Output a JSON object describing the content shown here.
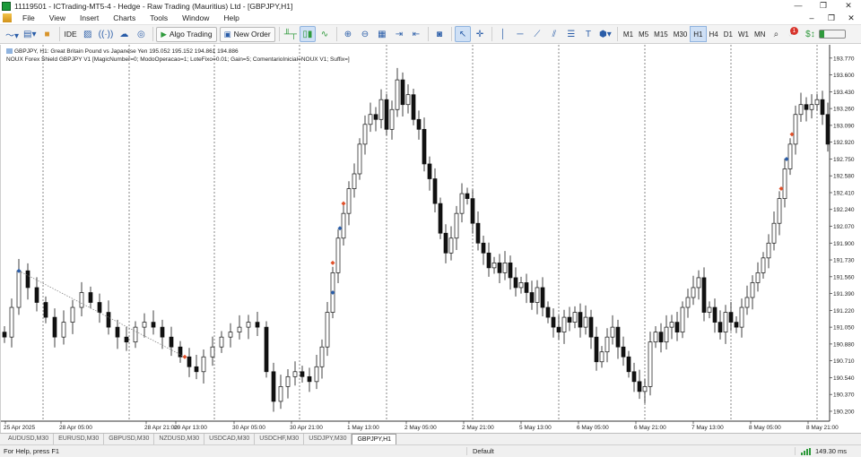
{
  "window": {
    "title": "11119501 - ICTrading-MT5-4 - Hedge - Raw Trading (Mauritius) Ltd - [GBPJPY,H1]",
    "minimize": "—",
    "restore": "❐",
    "close": "✕"
  },
  "menu": {
    "items": [
      "File",
      "View",
      "Insert",
      "Charts",
      "Tools",
      "Window",
      "Help"
    ],
    "right": [
      "–",
      "❐",
      "✕"
    ]
  },
  "toolbar": {
    "ide_label": "IDE",
    "algo_trading_label": "Algo Trading",
    "new_order_label": "New Order",
    "timeframes": [
      "M1",
      "M5",
      "M15",
      "M30",
      "H1",
      "H4",
      "D1",
      "W1",
      "MN"
    ],
    "active_timeframe": "H1",
    "notification_count": "1",
    "icons": {
      "chart-type": "line-chart-icon",
      "templates": "template-icon",
      "market": "market-icon",
      "signals": "signal-icon",
      "vps": "vps-icon",
      "zoom-in": "zoom-in-icon",
      "zoom-out": "zoom-out-icon",
      "crosshair": "crosshair-icon",
      "search": "search-icon"
    }
  },
  "chart": {
    "info_line1": "GBPJPY, H1:  Great Britain Pound vs Japanese Yen  195.052 195.152 194.861 194.886",
    "info_line2": "NOUX Forex Shield GBPJPY V1 [MagicNumber=0; ModoOperacao=1; LoteFixo=0.01; Gain=5; ComentarioInicial=NOUX V1; Suffix=]",
    "up_color": "#111111",
    "down_color": "#111111",
    "buy_marker_color": "#2a5da8",
    "sell_marker_color": "#e0502a",
    "price_labels": [
      "193.770",
      "193.600",
      "193.430",
      "193.260",
      "193.090",
      "192.920",
      "192.750",
      "192.580",
      "192.410",
      "192.240",
      "192.070",
      "191.900",
      "191.730",
      "191.560",
      "191.390",
      "191.220",
      "191.050",
      "190.880",
      "190.710",
      "190.540",
      "190.370",
      "190.200"
    ],
    "time_labels": [
      "25 Apr 2025",
      "28 Apr 05:00",
      "28 Apr 21:00",
      "29 Apr 13:00",
      "30 Apr 05:00",
      "30 Apr 21:00",
      "1 May 13:00",
      "2 May 05:00",
      "2 May 21:00",
      "5 May 13:00",
      "6 May 05:00",
      "6 May 21:00",
      "7 May 13:00",
      "8 May 05:00",
      "8 May 21:00"
    ],
    "ylim": [
      190.1,
      193.85
    ]
  },
  "bottom_tabs": {
    "items": [
      "AUDUSD,M30",
      "EURUSD,M30",
      "GBPUSD,M30",
      "NZDUSD,M30",
      "USDCAD,M30",
      "USDCHF,M30",
      "USDJPY,M30",
      "GBPJPY,H1"
    ],
    "active": "GBPJPY,H1"
  },
  "status": {
    "help": "For Help, press F1",
    "profile": "Default",
    "ping": "149.30 ms"
  }
}
